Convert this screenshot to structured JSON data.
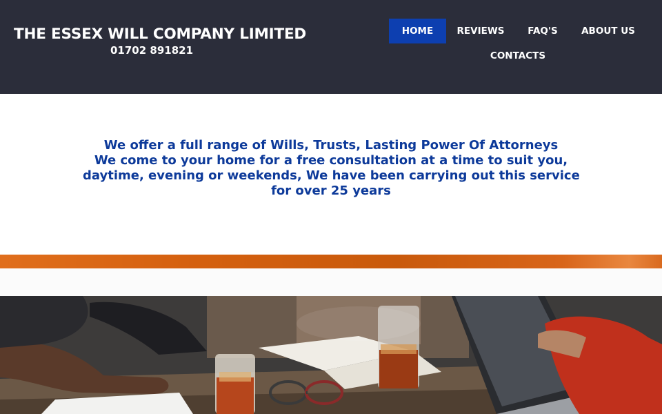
{
  "header": {
    "company_name": "THE ESSEX WILL COMPANY LIMITED",
    "phone": "01702 891821"
  },
  "nav": {
    "items": [
      {
        "label": "HOME",
        "active": true
      },
      {
        "label": "REVIEWS",
        "active": false
      },
      {
        "label": "FAQ'S",
        "active": false
      },
      {
        "label": "ABOUT US",
        "active": false
      },
      {
        "label": "CONTACTS",
        "active": false
      }
    ]
  },
  "intro": {
    "lines": [
      "We offer a full range of Wills, Trusts, Lasting Power Of Attorneys",
      "We come to your home for a free consultation at a time to suit you,",
      "daytime, evening or weekends, We have been carrying out this service",
      "for over 25 years"
    ]
  },
  "colors": {
    "header_bg": "#2b2d3a",
    "nav_active_bg": "#0d3fb0",
    "intro_text": "#0d3a9a",
    "accent_band": "#d4600f"
  }
}
